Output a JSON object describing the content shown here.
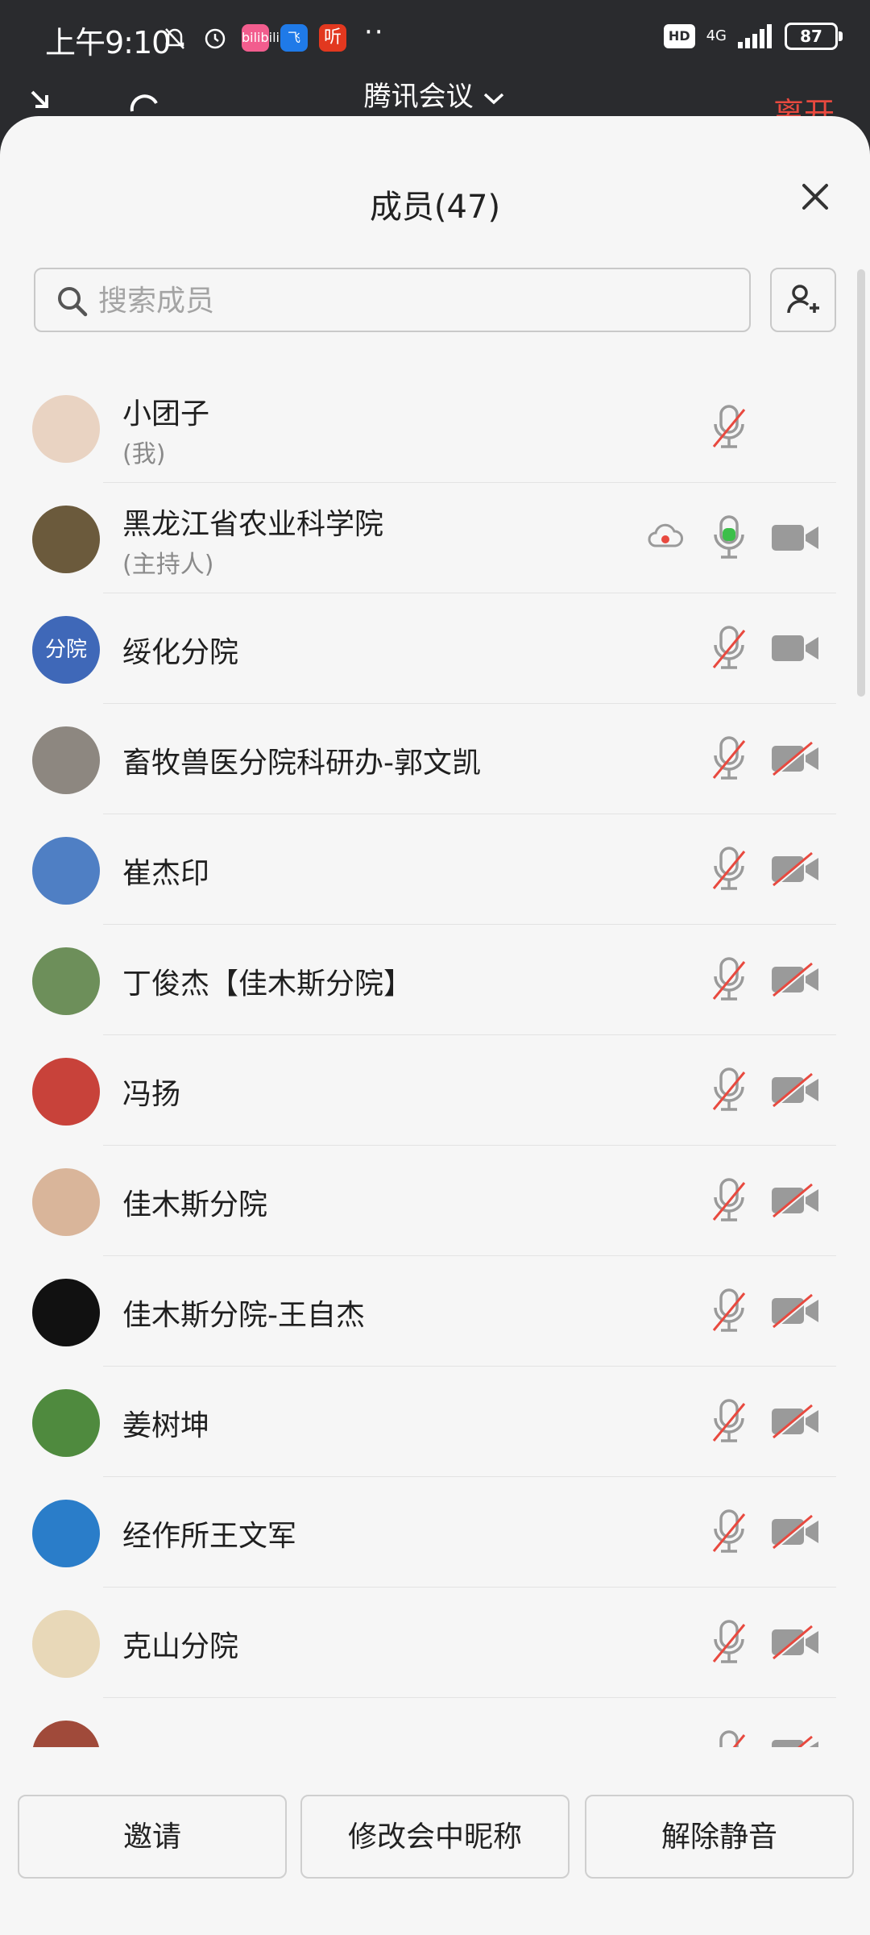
{
  "status_bar": {
    "time": "上午9:10",
    "apps": [
      "bilibili",
      "飞",
      "听"
    ],
    "hd": "HD",
    "network": "4G",
    "battery": "87"
  },
  "meeting": {
    "title": "腾讯会议",
    "leave_label": "离开"
  },
  "panel": {
    "title": "成员(47)",
    "search_placeholder": "搜索成员"
  },
  "members": [
    {
      "name": "小团子",
      "role": "(我)",
      "avatar_color": "#e9d3c2",
      "avatar_text": "",
      "mic": "muted",
      "cam": "none",
      "recording": false
    },
    {
      "name": "黑龙江省农业科学院",
      "role": "(主持人)",
      "avatar_color": "#6b5a3c",
      "avatar_text": "",
      "mic": "on",
      "cam": "on",
      "recording": true
    },
    {
      "name": "绥化分院",
      "role": "",
      "avatar_color": "#3f68b8",
      "avatar_text": "分院",
      "mic": "muted",
      "cam": "on",
      "recording": false
    },
    {
      "name": "畜牧兽医分院科研办-郭文凯",
      "role": "",
      "avatar_color": "#8d8780",
      "avatar_text": "",
      "mic": "muted",
      "cam": "off",
      "recording": false
    },
    {
      "name": "崔杰印",
      "role": "",
      "avatar_color": "#4f7fc4",
      "avatar_text": "",
      "mic": "muted",
      "cam": "off",
      "recording": false
    },
    {
      "name": "丁俊杰【佳木斯分院】",
      "role": "",
      "avatar_color": "#6d8f5a",
      "avatar_text": "",
      "mic": "muted",
      "cam": "off",
      "recording": false
    },
    {
      "name": "冯扬",
      "role": "",
      "avatar_color": "#c8423a",
      "avatar_text": "",
      "mic": "muted",
      "cam": "off",
      "recording": false
    },
    {
      "name": "佳木斯分院",
      "role": "",
      "avatar_color": "#d9b59a",
      "avatar_text": "",
      "mic": "muted",
      "cam": "off",
      "recording": false
    },
    {
      "name": "佳木斯分院-王自杰",
      "role": "",
      "avatar_color": "#111111",
      "avatar_text": "",
      "mic": "muted",
      "cam": "off",
      "recording": false
    },
    {
      "name": "姜树坤",
      "role": "",
      "avatar_color": "#4f8a3e",
      "avatar_text": "",
      "mic": "muted",
      "cam": "off",
      "recording": false
    },
    {
      "name": "经作所王文军",
      "role": "",
      "avatar_color": "#2a7dc9",
      "avatar_text": "",
      "mic": "muted",
      "cam": "off",
      "recording": false
    },
    {
      "name": "克山分院",
      "role": "",
      "avatar_color": "#e8d8b8",
      "avatar_text": "",
      "mic": "muted",
      "cam": "off",
      "recording": false
    },
    {
      "name": "",
      "role": "",
      "avatar_color": "#a04a3a",
      "avatar_text": "",
      "mic": "muted",
      "cam": "off",
      "recording": false
    }
  ],
  "buttons": {
    "invite": "邀请",
    "rename": "修改会中昵称",
    "unmute": "解除静音"
  },
  "colors": {
    "accent_red": "#e8493f",
    "mic_on_green": "#3cbf4a",
    "icon_gray": "#9a9a9a"
  }
}
